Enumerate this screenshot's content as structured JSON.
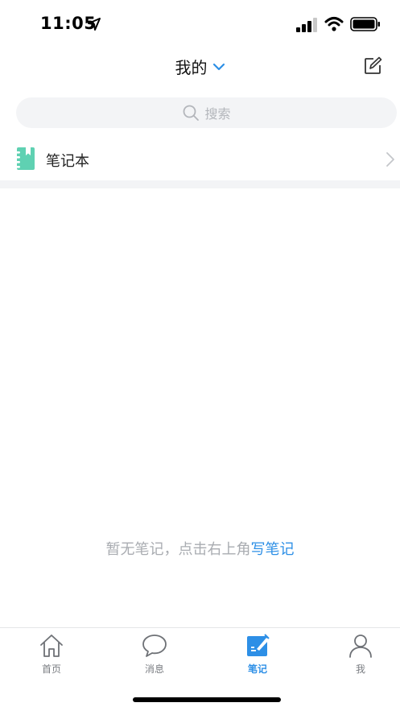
{
  "status_bar": {
    "time": "11:05",
    "location_icon": "location-arrow-icon",
    "signal_icon": "cellular-signal-icon",
    "wifi_icon": "wifi-icon",
    "battery_icon": "battery-icon"
  },
  "header": {
    "title": "我的",
    "dropdown_icon": "chevron-down-icon",
    "compose_icon": "compose-icon"
  },
  "search": {
    "placeholder": "搜索",
    "icon": "search-icon"
  },
  "notebook_row": {
    "label": "笔记本",
    "icon": "notebook-icon",
    "chevron_icon": "chevron-right-icon"
  },
  "empty_state": {
    "text": "暂无笔记，点击右上角",
    "link": "写笔记"
  },
  "tab_bar": {
    "tabs": [
      {
        "label": "首页",
        "icon": "home-icon",
        "active": false
      },
      {
        "label": "消息",
        "icon": "chat-bubble-icon",
        "active": false
      },
      {
        "label": "笔记",
        "icon": "note-pen-icon",
        "active": true
      },
      {
        "label": "我",
        "icon": "person-icon",
        "active": false
      }
    ]
  },
  "colors": {
    "accent": "#2d8fe6",
    "notebook_green": "#5fd1b2",
    "search_bg": "#f3f4f6",
    "muted_text": "#a9acb1"
  }
}
